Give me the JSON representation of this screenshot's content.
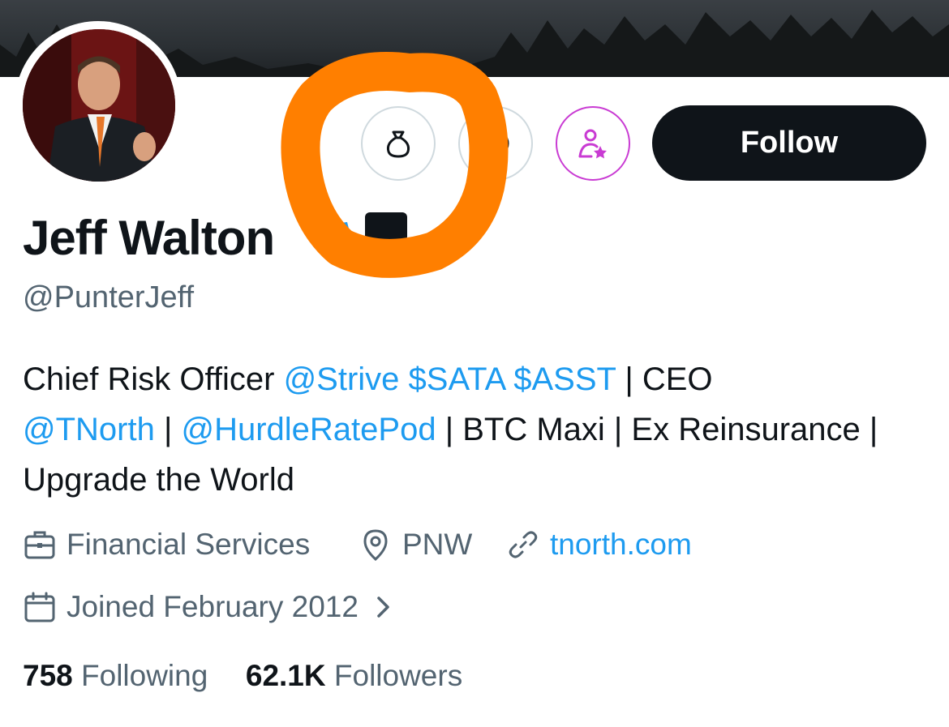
{
  "profile": {
    "name": "Jeff Walton",
    "handle": "@PunterJeff",
    "bio": {
      "t1": "Chief Risk Officer ",
      "m1": "@Strive",
      "t2": " ",
      "m2": "$SATA",
      "t3": " ",
      "m3": "$ASST",
      "t4": " | CEO",
      "m4": "@TNorth",
      "t5": " | ",
      "m5": "@HurdleRatePod",
      "t6": " | BTC Maxi | Ex Reinsurance | Upgrade the World"
    },
    "category": "Financial Services",
    "location": "PNW",
    "website": "tnorth.com",
    "joined": "Joined February 2012",
    "following_count": "758",
    "following_label": "Following",
    "followers_count": "62.1K",
    "followers_label": "Followers"
  },
  "actions": {
    "follow_label": "Follow"
  },
  "icons": {
    "tip": "money-bag-icon",
    "message": "message-icon",
    "subscribe": "person-star-icon",
    "verified": "verified-badge-icon"
  },
  "colors": {
    "accent": "#1d9bf0",
    "subscribe": "#c93bd3",
    "annotation": "#ff7f00",
    "text": "#0f1419",
    "secondary": "#536471"
  }
}
